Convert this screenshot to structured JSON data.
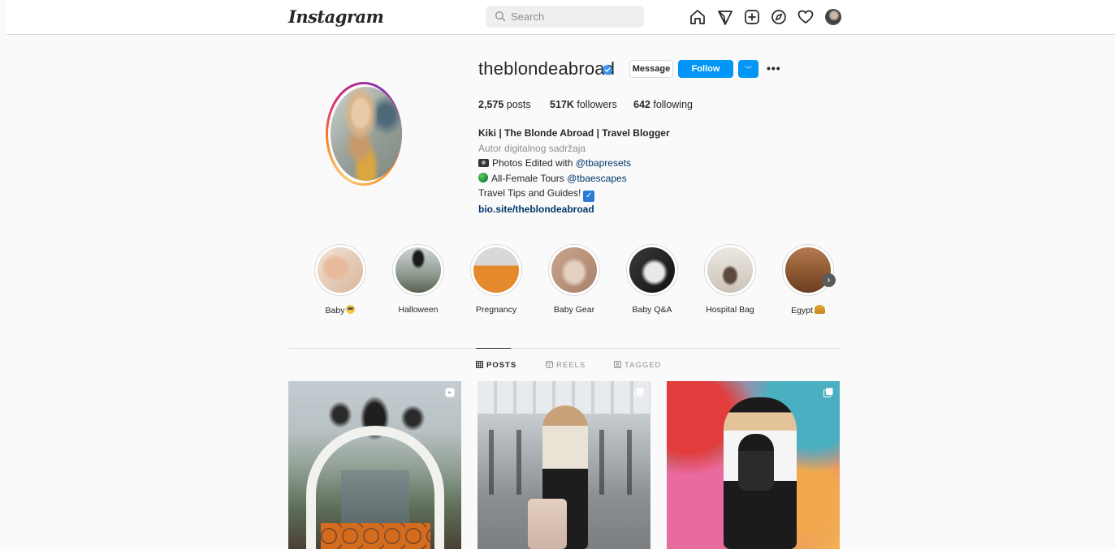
{
  "nav": {
    "logo": "Instagram",
    "logo_chevron": "⌵",
    "search_placeholder": "Search",
    "icons": [
      "home-icon",
      "direct-icon",
      "new-post-icon",
      "explore-icon",
      "activity-icon",
      "profile-avatar"
    ]
  },
  "profile": {
    "username": "theblondeabroad",
    "verified": true,
    "buttons": {
      "message": "Message",
      "follow": "Follow",
      "dropdown": "﹀",
      "more": "•••"
    },
    "stats": [
      {
        "count": "2,575",
        "label": "posts"
      },
      {
        "count": "517K",
        "label": "followers"
      },
      {
        "count": "642",
        "label": "following"
      }
    ],
    "bio": {
      "name": "Kiki | The Blonde Abroad | Travel Blogger",
      "category": "Autor digitalnog sadržaja",
      "line1_text": "Photos Edited with ",
      "line1_mention": "@tbapresets",
      "line2_text": "All-Female Tours ",
      "line2_mention": "@tbaescapes",
      "line3_text": "Travel Tips and Guides!",
      "line3_check": "✓",
      "link": "bio.site/theblondeabroad"
    }
  },
  "highlights": [
    {
      "label": "Baby"
    },
    {
      "label": "Halloween"
    },
    {
      "label": "Pregnancy"
    },
    {
      "label": "Baby Gear"
    },
    {
      "label": "Baby Q&A"
    },
    {
      "label": "Hospital Bag"
    },
    {
      "label": "Egypt"
    }
  ],
  "highlights_next": "›",
  "tabs": [
    {
      "label": "POSTS",
      "active": true
    },
    {
      "label": "REELS",
      "active": false
    },
    {
      "label": "TAGGED",
      "active": false
    }
  ],
  "colors": {
    "accent": "#0095f6",
    "link": "#00376b",
    "muted": "#8e8e8e",
    "border": "#dbdbdb"
  }
}
